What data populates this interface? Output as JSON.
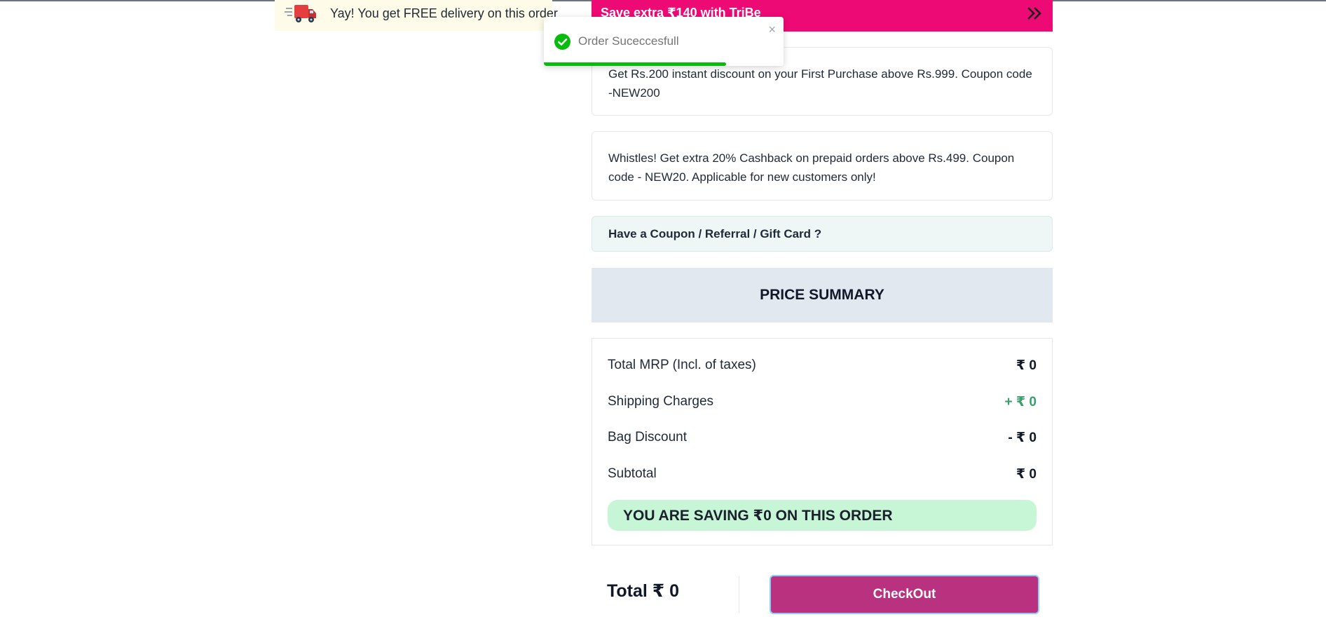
{
  "banner": {
    "delivery_text": "Yay! You get FREE delivery on this order",
    "truck_icon": "delivery-truck-icon",
    "tribe_text": "Save extra ₹140 with TriBe",
    "tribe_arrow_icon": "double-chevron-right-icon"
  },
  "toast": {
    "message": "Order Suceccesfull",
    "status_icon": "check-circle-icon",
    "close_glyph": "×",
    "progress": 0.76
  },
  "offers": [
    {
      "text": "Get Rs.200 instant discount on your First Purchase above Rs.999. Coupon code -NEW200"
    },
    {
      "text": "Whistles! Get extra 20% Cashback on prepaid orders above Rs.499. Coupon code - NEW20. Applicable for new customers only!"
    }
  ],
  "coupon": {
    "label": "Have a Coupon / Referral / Gift Card ?"
  },
  "price_summary": {
    "title": "PRICE SUMMARY",
    "rows": [
      {
        "label": "Total MRP (Incl. of taxes)",
        "value": "₹ 0"
      },
      {
        "label": "Shipping Charges",
        "value": "+ ₹ 0"
      },
      {
        "label": "Bag Discount",
        "value": "- ₹ 0"
      },
      {
        "label": "Subtotal",
        "value": "₹ 0"
      }
    ],
    "saving_text": "YOU ARE SAVING ₹0 ON THIS ORDER"
  },
  "footer": {
    "total_label": "Total ₹ 0",
    "checkout_label": "CheckOut"
  },
  "colors": {
    "tribe_pink": "#ee0a74",
    "checkout_magenta": "#b83280",
    "shipping_green": "#38a169",
    "saving_bg": "#c6f6d5",
    "toast_success": "#07bc0c"
  }
}
